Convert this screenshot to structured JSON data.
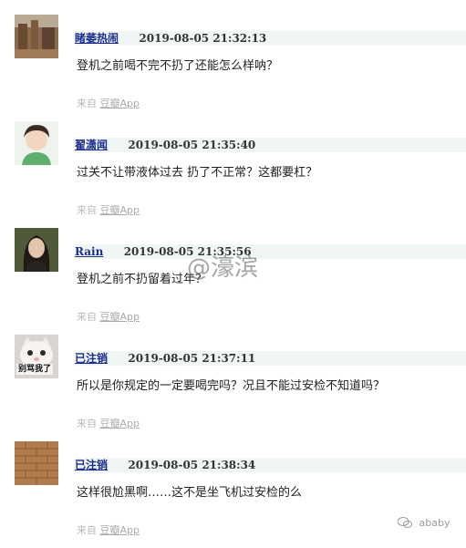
{
  "comments": [
    {
      "author": "睹萎热闹",
      "timestamp": "2019-08-05 21:32:13",
      "text": "登机之前喝不完不扔了还能怎么样呐？",
      "source_prefix": "来自",
      "source_app": "豆瓣App"
    },
    {
      "author": "翟潇闻",
      "timestamp": "2019-08-05 21:35:40",
      "text": "过关不让带液体过去 扔了不正常？这都要杠？",
      "source_prefix": "来自",
      "source_app": "豆瓣App"
    },
    {
      "author": "Rain",
      "timestamp": "2019-08-05 21:35:56",
      "text": "登机之前不扔留着过年？",
      "source_prefix": "来自",
      "source_app": "豆瓣App"
    },
    {
      "author": "已注销",
      "timestamp": "2019-08-05 21:37:11",
      "text": "所以是你规定的一定要喝完吗？况且不能过安检不知道吗？",
      "source_prefix": "来自",
      "source_app": "豆瓣App",
      "avatar_caption": "别骂我了"
    },
    {
      "author": "已注销",
      "timestamp": "2019-08-05 21:38:34",
      "text": "这样很尬黑啊……这不是坐飞机过安检的么",
      "source_prefix": "来自",
      "source_app": "豆瓣App"
    }
  ],
  "watermarks": {
    "weibo": "@濠滨",
    "wechat": "ababy"
  },
  "colors": {
    "meta_bar": "#f0f6f3",
    "author_link": "#1b2d8f",
    "source_text": "#b8b8b8"
  }
}
